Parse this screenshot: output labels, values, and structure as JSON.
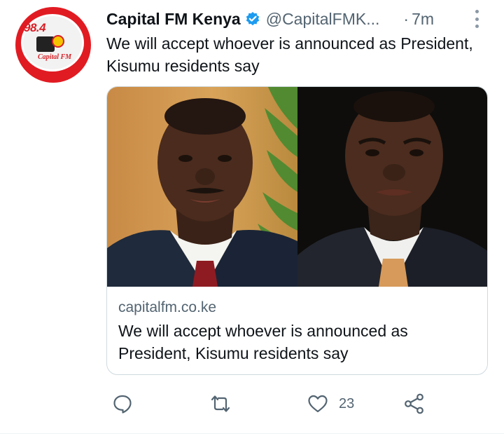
{
  "tweet": {
    "avatar": {
      "frequency": "98.4",
      "brand": "Capital FM"
    },
    "author": {
      "display_name": "Capital FM Kenya",
      "verified": true,
      "handle": "@CapitalFMK...",
      "separator": "·",
      "time": "7m"
    },
    "text": "We will accept whoever is announced as President, Kisumu residents say",
    "card": {
      "domain": "capitalfm.co.ke",
      "title": "We will accept whoever is announced as President, Kisumu residents say"
    },
    "actions": {
      "reply_icon": "reply-icon",
      "retweet_icon": "retweet-icon",
      "like_icon": "heart-icon",
      "like_count": "23",
      "share_icon": "share-icon"
    }
  },
  "colors": {
    "text": "#0f1419",
    "secondary": "#536471",
    "verified": "#1d9bf0",
    "border": "#cfd9de",
    "brand_red": "#e11b22"
  }
}
